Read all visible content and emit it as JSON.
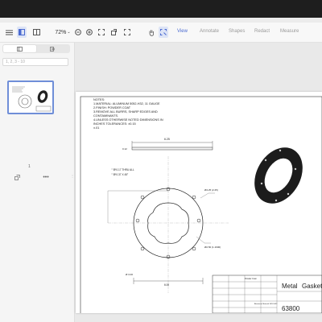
{
  "toolbar": {
    "zoom": "72%",
    "tabs": [
      {
        "label": "View",
        "active": true
      },
      {
        "label": "Annotate",
        "active": false
      },
      {
        "label": "Shapes",
        "active": false
      },
      {
        "label": "Redact",
        "active": false
      },
      {
        "label": "Measure",
        "active": false
      }
    ]
  },
  "sidebar": {
    "page_input_placeholder": "1, 2, 3 - 10",
    "pages": [
      {
        "number": "1"
      }
    ]
  },
  "drawing": {
    "notes_heading": "NOTES:",
    "notes": [
      "1.MATERIAL:  ALUMINUM  5052-H32,  11  GAUGE",
      "2.FINISH: POWDER COAT",
      "3.REMOVE ALL BURRS, SHARP EDGES AND",
      "CONTAMINANTS.",
      "4.UNLESS OTHERWISE NOTED DIMENSIONS IN",
      "INCHES TOLERANCES: ±0.15",
      "±.01"
    ],
    "dim_top": "6.25",
    "dim_thickness": "0.12",
    "dim_hole_callout": "Ø 0.17 THRU ALL",
    "dim_chamfer": "Ø 0.37 X 45°",
    "dim_hole_right": "Ø4.25 (2.25)",
    "dim_right_mid": "Ø2.50 (1.1600)",
    "dim_bottom_left": "Ø 3.00",
    "dim_bottom": "6.00",
    "title_block": {
      "title_1": "Metal",
      "title_2": "Gasket",
      "part_number": "63800",
      "finish_label": "Powder Coat",
      "material_label": "Aluminum Material 5052-H32"
    }
  }
}
